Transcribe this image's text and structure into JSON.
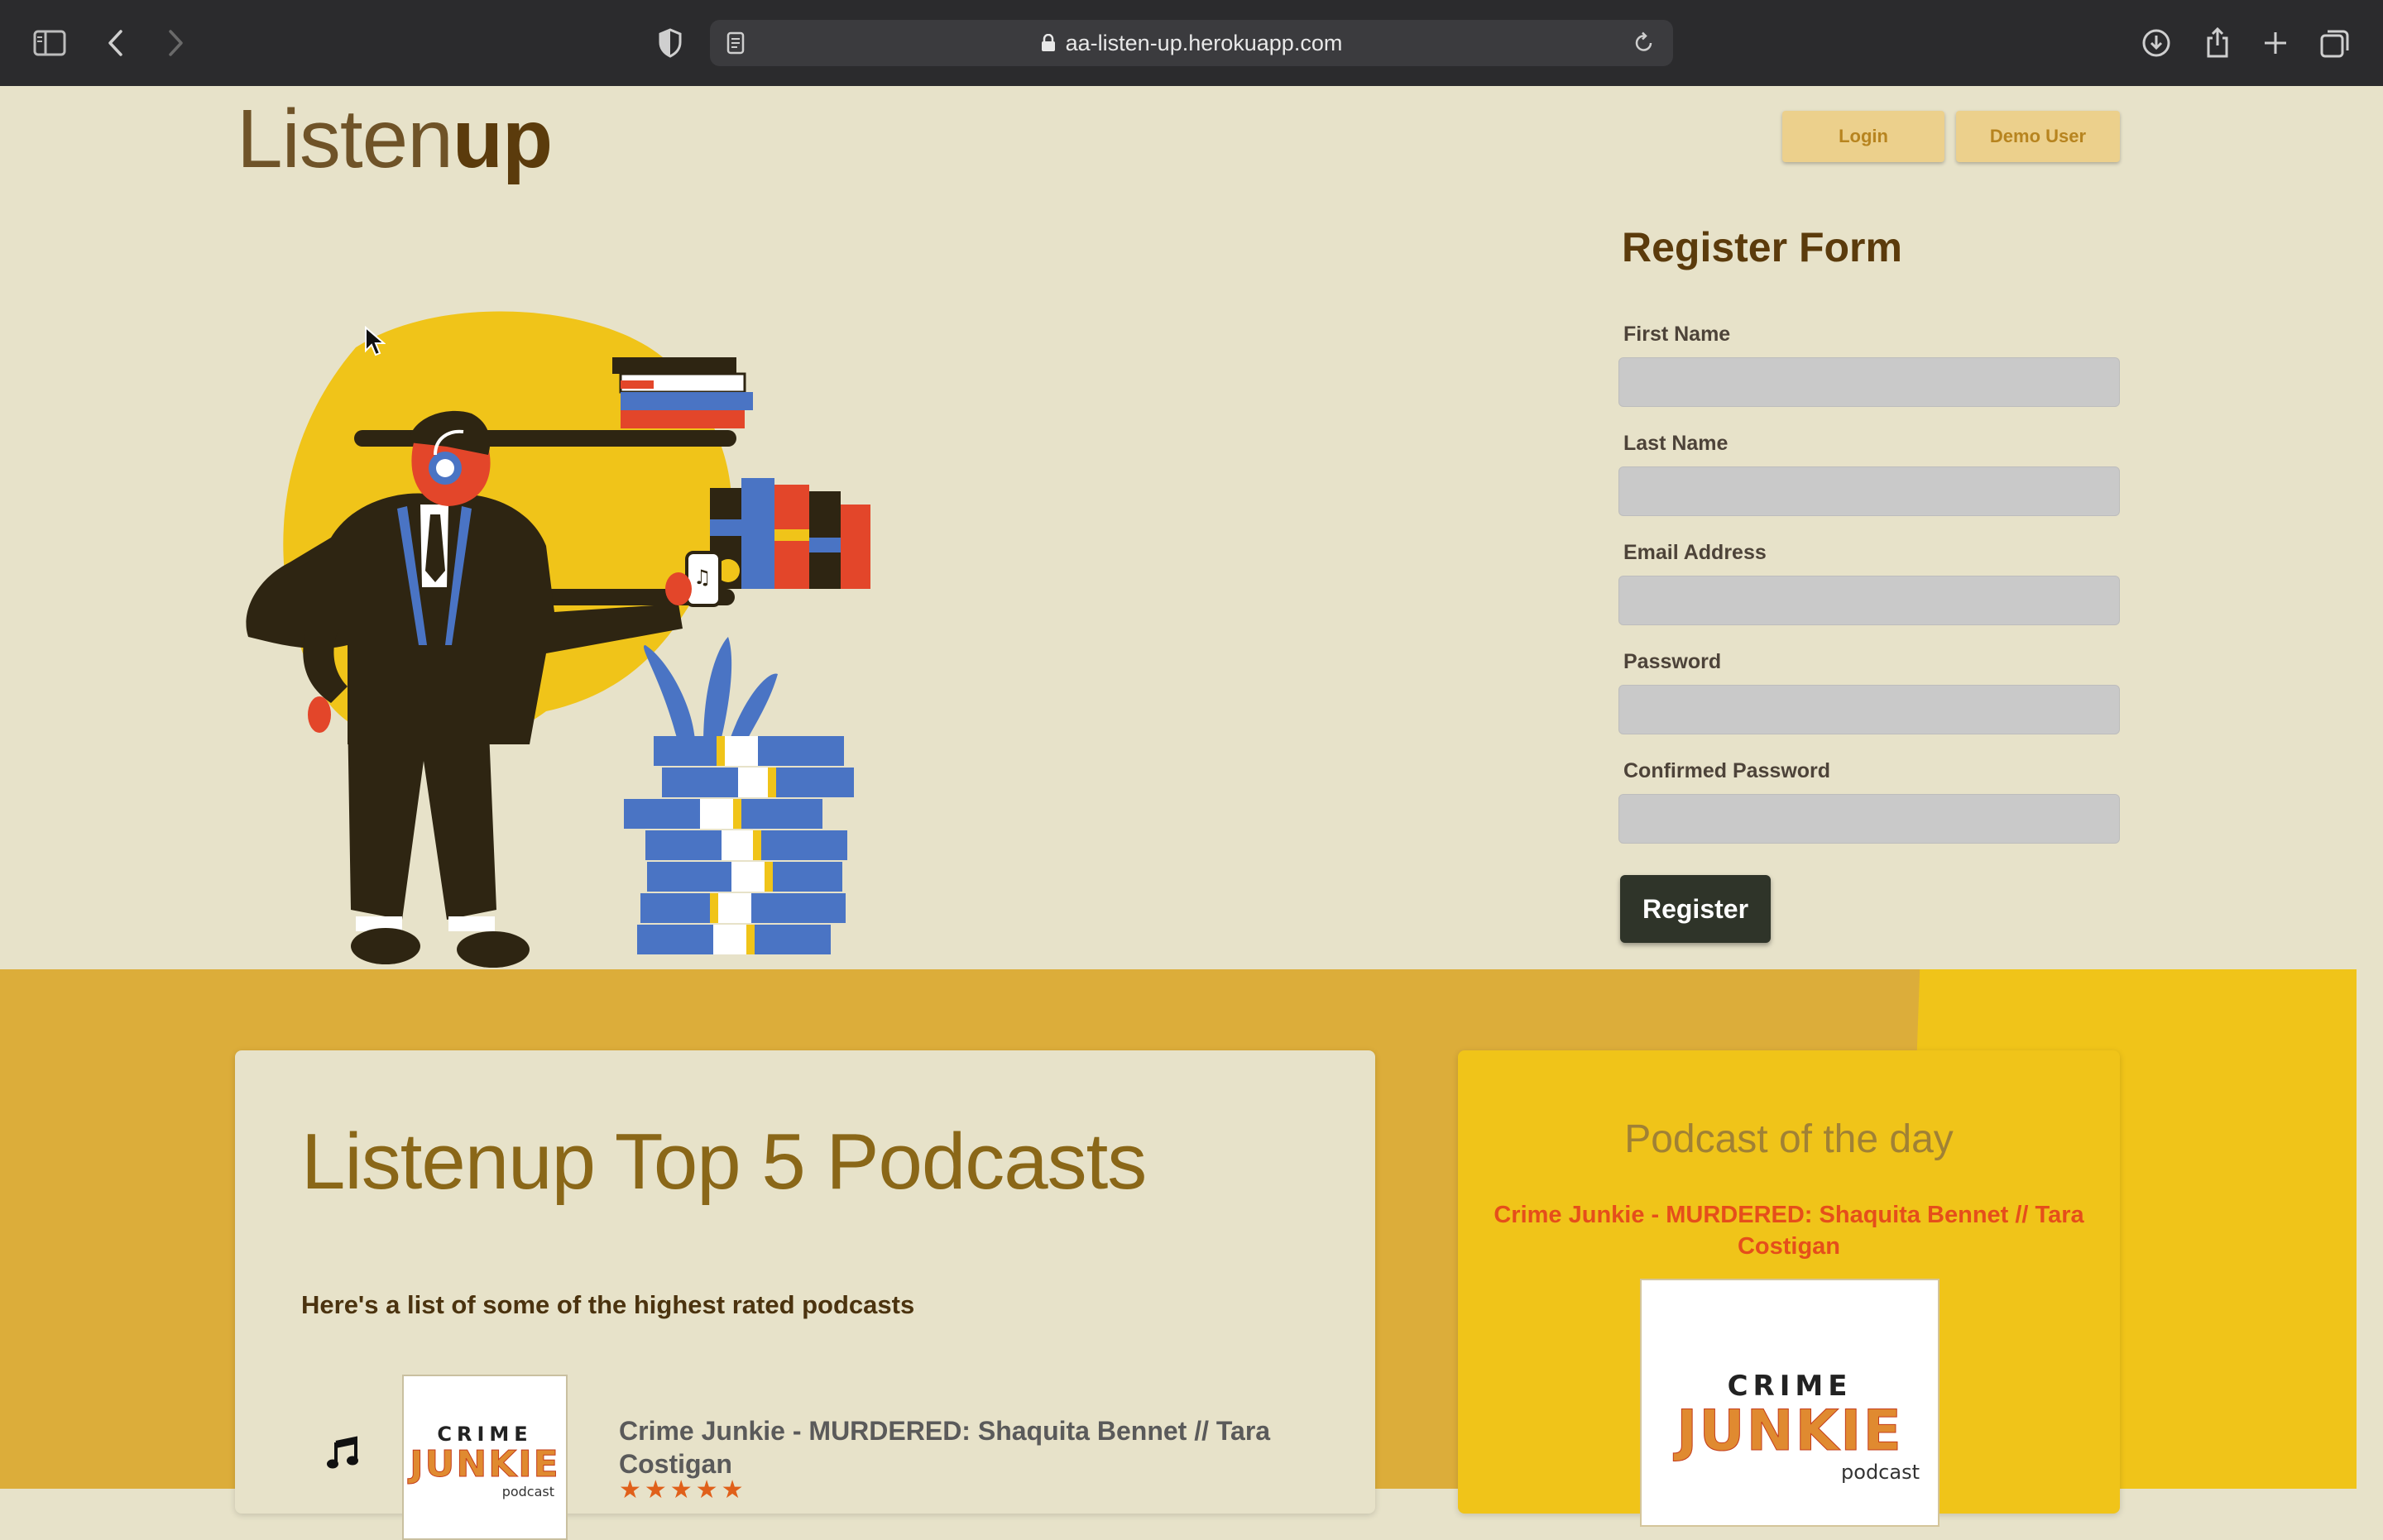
{
  "browser": {
    "url": "aa-listen-up.herokuapp.com",
    "icons": [
      "sidebar-icon",
      "back-icon",
      "forward-icon",
      "privacy-shield-icon",
      "reader-icon",
      "lock-icon",
      "reload-icon",
      "download-icon",
      "share-icon",
      "new-tab-icon",
      "tabs-overview-icon"
    ]
  },
  "header": {
    "logo_light": "Listen",
    "logo_bold": "up",
    "login_label": "Login",
    "demo_label": "Demo User"
  },
  "register": {
    "title": "Register Form",
    "fields": [
      {
        "label": "First Name",
        "value": ""
      },
      {
        "label": "Last Name",
        "value": ""
      },
      {
        "label": "Email Address",
        "value": ""
      },
      {
        "label": "Password",
        "value": ""
      },
      {
        "label": "Confirmed Password",
        "value": ""
      }
    ],
    "submit_label": "Register"
  },
  "top5": {
    "title": "Listenup Top 5 Podcasts",
    "subtitle": "Here's a list of some of the highest rated podcasts",
    "items": [
      {
        "title": "Crime Junkie - MURDERED: Shaquita Bennet // Tara Costigan",
        "stars": "★★★★★",
        "cover_line1": "CRIME",
        "cover_line2": "JUNKIE",
        "cover_line3": "podcast"
      }
    ]
  },
  "potd": {
    "title": "Podcast of the day",
    "name": "Crime Junkie - MURDERED: Shaquita Bennet // Tara Costigan",
    "cover_line1": "CRIME",
    "cover_line2": "JUNKIE",
    "cover_line3": "podcast"
  },
  "colors": {
    "chrome": "#2b2b2d",
    "page_bg": "#e7e2c9",
    "brand_brown": "#5b3b0c",
    "band_mustard": "#dcad3a",
    "band_yellow": "#f0c419",
    "accent_orange": "#e54e1b",
    "button_dark": "#2f3429"
  }
}
